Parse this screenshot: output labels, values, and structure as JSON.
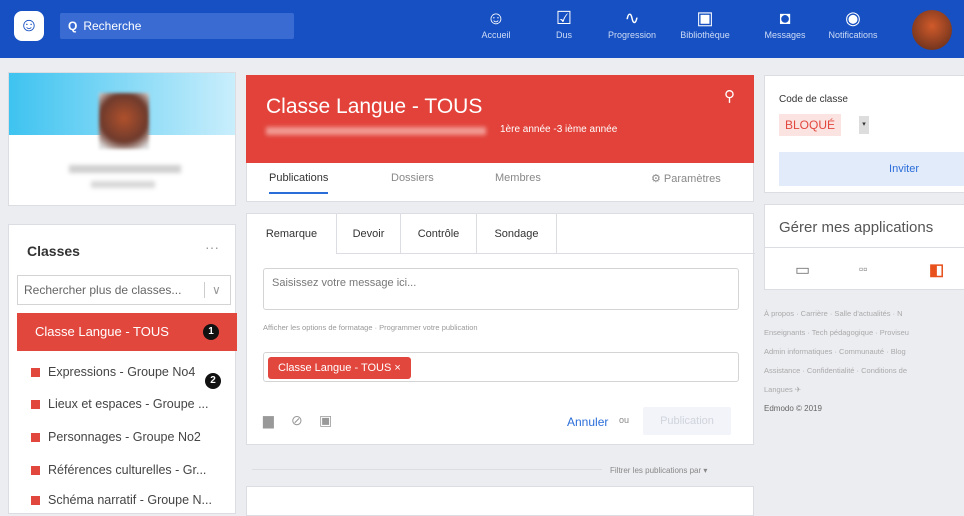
{
  "topbar": {
    "search_placeholder": "Recherche",
    "nav": [
      {
        "icon": "accueil-icon",
        "label": "Accueil",
        "glyph": "☺"
      },
      {
        "icon": "dus-icon",
        "label": "Dus",
        "glyph": "☑"
      },
      {
        "icon": "progression-icon",
        "label": "Progression",
        "glyph": "∿"
      },
      {
        "icon": "bibliotheque-icon",
        "label": "Bibliothèque",
        "glyph": "▣"
      },
      {
        "icon": "messages-icon",
        "label": "Messages",
        "glyph": "◘"
      },
      {
        "icon": "notifications-icon",
        "label": "Notifications",
        "glyph": "◉"
      }
    ]
  },
  "sidebar": {
    "title": "Classes",
    "more": "···",
    "search_placeholder": "Rechercher plus de classes...",
    "active_class": "Classe Langue - TOUS",
    "badge1": "1",
    "badge2": "2",
    "classes": [
      "Expressions - Groupe No4",
      "Lieux et espaces - Groupe ...",
      "Personnages - Groupe No2",
      "Références culturelles - Gr...",
      "Schéma narratif - Groupe N..."
    ]
  },
  "header": {
    "title": "Classe Langue - TOUS",
    "subtitle": "1ère année -3 ième année"
  },
  "tabs": {
    "publications": "Publications",
    "dossiers": "Dossiers",
    "membres": "Membres",
    "parametres": "Paramètres"
  },
  "composer": {
    "tabs": [
      "Remarque",
      "Devoir",
      "Contrôle",
      "Sondage"
    ],
    "message_placeholder": "Saisissez votre message ici...",
    "options_text": "Afficher les options de formatage · Programmer votre publication",
    "recipient_chip": "Classe Langue - TOUS ×",
    "cancel": "Annuler",
    "or": "ou",
    "publish": "Publication"
  },
  "feed": {
    "filter": "Filtrer les publications par ▾"
  },
  "code": {
    "label": "Code de classe",
    "value": "BLOQUÉ",
    "invite": "Inviter"
  },
  "apps": {
    "title": "Gérer mes applications"
  },
  "footer": {
    "lines": [
      "À propos · Carrière · Salle d'actualités · N",
      "Enseignants · Tech pédagogique · Proviseu",
      "Admin informatiques · Communauté · Blog",
      "Assistance · Confidentialité · Conditions de",
      "Langues"
    ],
    "copyright": "Edmodo © 2019"
  }
}
